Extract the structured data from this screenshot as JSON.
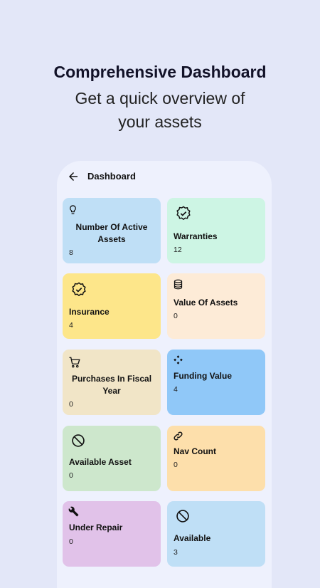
{
  "hero": {
    "title": "Comprehensive Dashboard",
    "subtitle": "Get a quick overview of your assets"
  },
  "appbar": {
    "title": "Dashboard",
    "back_icon": "arrow-left-icon"
  },
  "cards": [
    {
      "label": "Number Of Active Assets",
      "value": "8",
      "icon": "lightbulb-icon",
      "color": "#bfdff6"
    },
    {
      "label": "Warranties",
      "value": "12",
      "icon": "verified-badge-icon",
      "color": "#cdf5e4"
    },
    {
      "label": "Insurance",
      "value": "4",
      "icon": "verified-badge-icon",
      "color": "#fde68a"
    },
    {
      "label": "Value Of Assets",
      "value": "0",
      "icon": "database-icon",
      "color": "#fdebd7"
    },
    {
      "label": "Purchases In Fiscal Year",
      "value": "0",
      "icon": "cart-icon",
      "color": "#f1e5c7"
    },
    {
      "label": "Funding Value",
      "value": "4",
      "icon": "diamond-grid-icon",
      "color": "#90c8f8"
    },
    {
      "label": "Available Asset",
      "value": "0",
      "icon": "prohibited-icon",
      "color": "#cde7cc"
    },
    {
      "label": "Nav Count",
      "value": "0",
      "icon": "link-icon",
      "color": "#fddfab"
    },
    {
      "label": "Under Repair",
      "value": "0",
      "icon": "wrench-icon",
      "color": "#e1c2e9"
    },
    {
      "label": "Available",
      "value": "3",
      "icon": "prohibited-icon",
      "color": "#bfdff6"
    }
  ]
}
